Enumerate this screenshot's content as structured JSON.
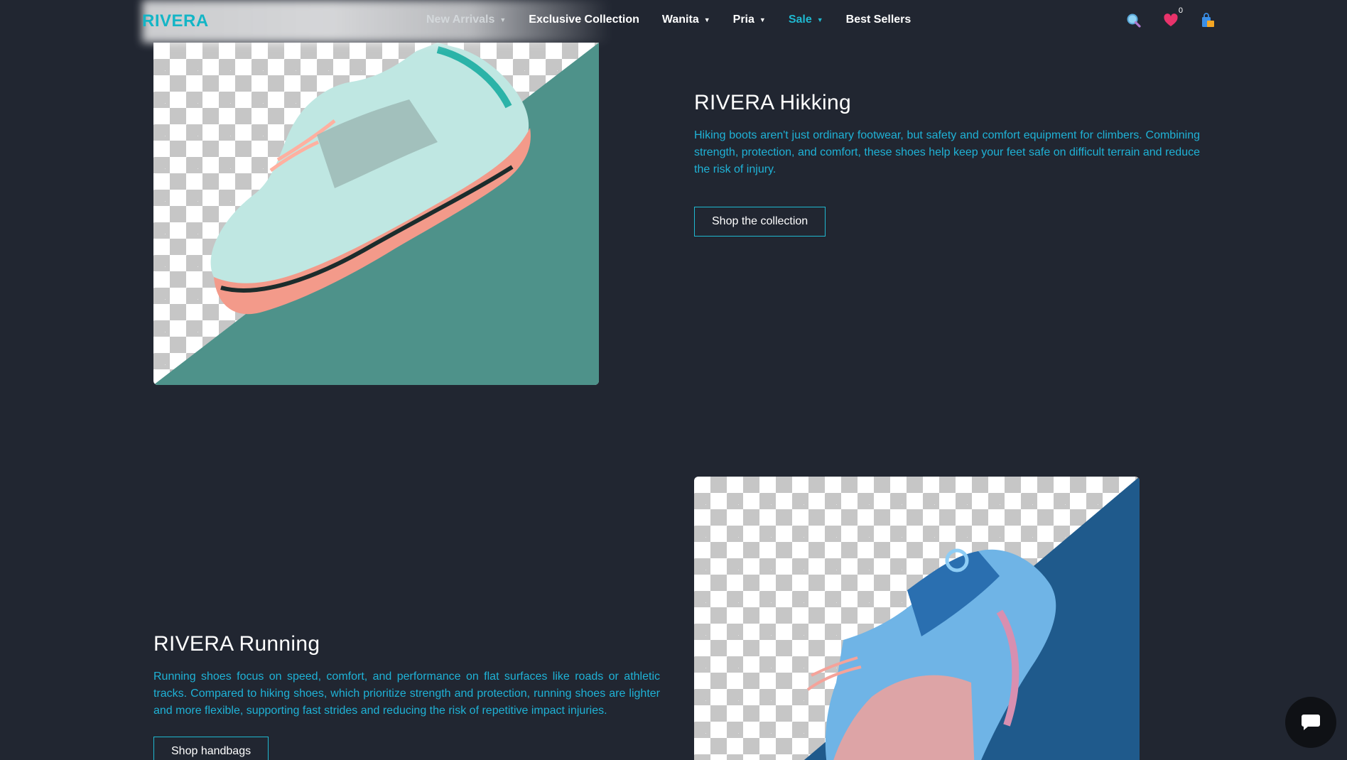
{
  "header": {
    "logo": "RIVERA",
    "nav": [
      {
        "label": "New Arrivals",
        "has_caret": true
      },
      {
        "label": "Exclusive Collection",
        "has_caret": false
      },
      {
        "label": "Wanita",
        "has_caret": true
      },
      {
        "label": "Pria",
        "has_caret": true
      },
      {
        "label": "Sale",
        "has_caret": true
      },
      {
        "label": "Best Sellers",
        "has_caret": false
      }
    ],
    "caret_glyph": "▼",
    "icons": [
      "search-icon",
      "heart-icon",
      "shopping-bag-icon"
    ],
    "wishlist_count": "0"
  },
  "sections": [
    {
      "title": "RIVERA Hikking",
      "description": "Hiking boots aren't just ordinary footwear, but safety and comfort equipment for climbers. Combining strength, protection, and comfort, these shoes help keep your feet safe on difficult terrain and reduce the risk of injury.",
      "button": "Shop the collection",
      "image_accent": "#4e928a"
    },
    {
      "title": "RIVERA Running",
      "description": "Running shoes focus on speed, comfort, and performance on flat surfaces like roads or athletic tracks. Compared to hiking shoes, which prioritize strength and protection, running shoes are lighter and more flexible, supporting fast strides and reducing the risk of repetitive impact injuries.",
      "button": "Shop handbags",
      "image_accent": "#1f5a8c"
    }
  ],
  "colors": {
    "background": "#212631",
    "accent": "#13b5c6",
    "text_accent": "#1fb2d6"
  },
  "chat_icon": "chat-bubble-icon"
}
